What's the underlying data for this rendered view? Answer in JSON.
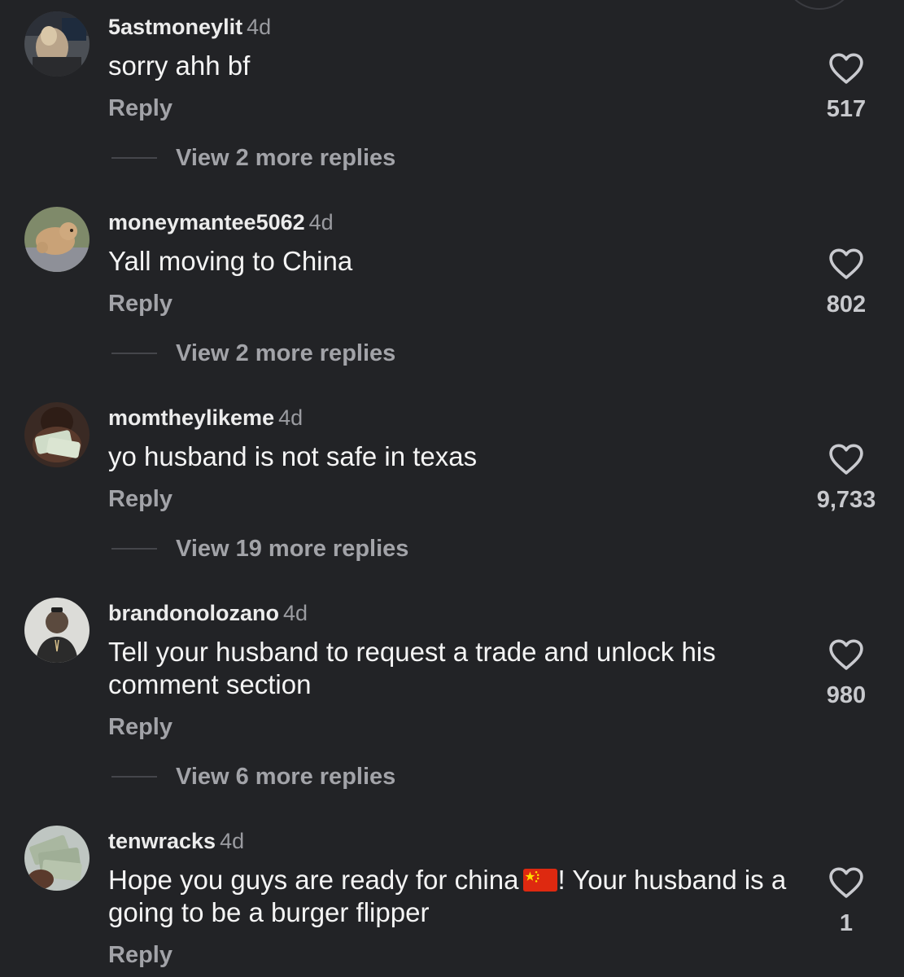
{
  "comments": [
    {
      "username": "5astmoneylit",
      "time": "4d",
      "text": "sorry ahh bf",
      "reply_label": "Reply",
      "likes": "517",
      "more_replies": "View 2 more replies"
    },
    {
      "username": "moneymantee5062",
      "time": "4d",
      "text": "Yall moving to China",
      "reply_label": "Reply",
      "likes": "802",
      "more_replies": "View 2 more replies"
    },
    {
      "username": "momtheylikeme",
      "time": "4d",
      "text": "yo husband is not safe in texas",
      "reply_label": "Reply",
      "likes": "9,733",
      "more_replies": "View 19 more replies"
    },
    {
      "username": "brandonolozano",
      "time": "4d",
      "text": "Tell your husband to request a trade and unlock his comment section",
      "reply_label": "Reply",
      "likes": "980",
      "more_replies": "View 6 more replies"
    },
    {
      "username": "tenwracks",
      "time": "4d",
      "text_before_flag": "Hope you guys are ready for china",
      "flag_icon": "china-flag-icon",
      "text_after_flag": "! Your husband is a going to be a burger flipper",
      "reply_label": "Reply",
      "likes": "1"
    }
  ],
  "icons": {
    "like": "heart-outline-icon"
  },
  "colors": {
    "background": "#222326",
    "primary_text": "#f4f4f4",
    "secondary_text": "#a2a3a8",
    "timestamp": "#9a9ba0"
  }
}
